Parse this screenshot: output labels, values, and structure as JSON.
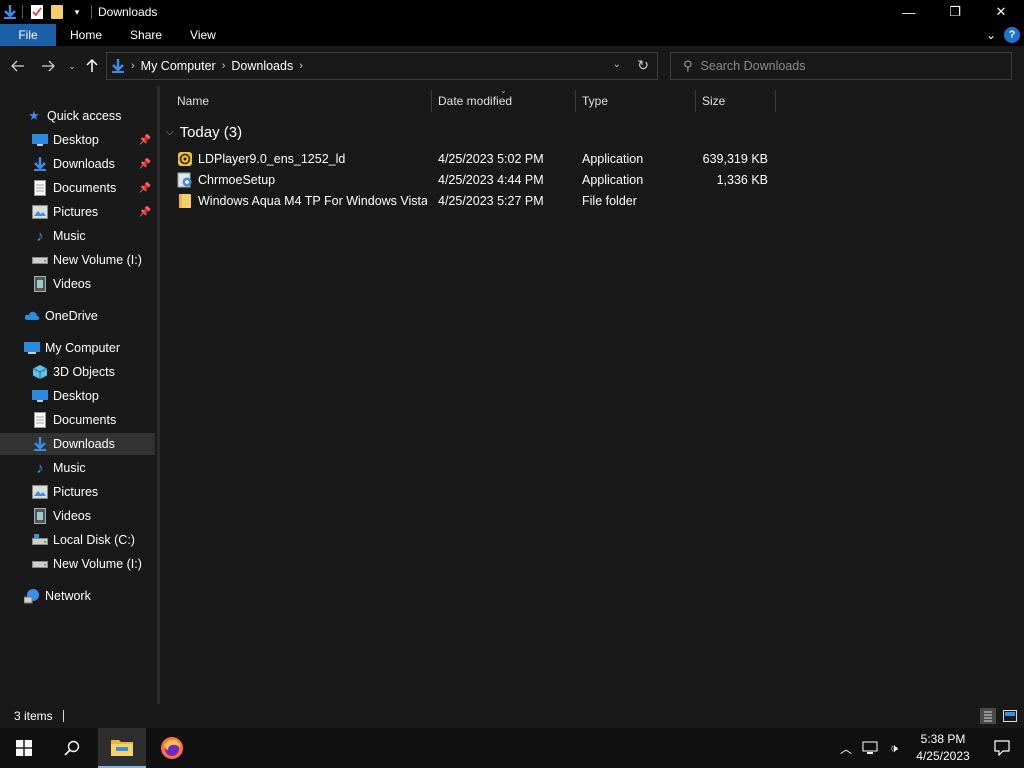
{
  "window": {
    "title": "Downloads",
    "controls": {
      "minimize": "—",
      "maximize": "❐",
      "close": "✕"
    }
  },
  "ribbon": {
    "tabs": [
      {
        "label": "File"
      },
      {
        "label": "Share"
      },
      {
        "label": "View"
      }
    ],
    "home_label": "Home",
    "expand_icon": "chevron-down-icon",
    "help": "?"
  },
  "address": {
    "crumbs": [
      "My Computer",
      "Downloads"
    ],
    "search_placeholder": "Search Downloads"
  },
  "nav": {
    "quick_access": "Quick access",
    "quick_items": [
      {
        "label": "Desktop",
        "icon": "desktop-icon",
        "pinned": true
      },
      {
        "label": "Downloads",
        "icon": "downloads-icon",
        "pinned": true
      },
      {
        "label": "Documents",
        "icon": "documents-icon",
        "pinned": true
      },
      {
        "label": "Pictures",
        "icon": "pictures-icon",
        "pinned": true
      },
      {
        "label": "Music",
        "icon": "music-icon",
        "pinned": false
      },
      {
        "label": "New Volume (I:)",
        "icon": "drive-icon",
        "pinned": false
      },
      {
        "label": "Videos",
        "icon": "videos-icon",
        "pinned": false
      }
    ],
    "onedrive": "OneDrive",
    "my_computer": "My Computer",
    "computer_items": [
      {
        "label": "3D Objects",
        "icon": "3d-objects-icon"
      },
      {
        "label": "Desktop",
        "icon": "desktop-icon"
      },
      {
        "label": "Documents",
        "icon": "documents-icon"
      },
      {
        "label": "Downloads",
        "icon": "downloads-icon",
        "selected": true
      },
      {
        "label": "Music",
        "icon": "music-icon"
      },
      {
        "label": "Pictures",
        "icon": "pictures-icon"
      },
      {
        "label": "Videos",
        "icon": "videos-icon"
      },
      {
        "label": "Local Disk (C:)",
        "icon": "local-disk-icon"
      },
      {
        "label": "New Volume (I:)",
        "icon": "drive-icon"
      }
    ],
    "network": "Network"
  },
  "columns": {
    "name": "Name",
    "date": "Date modified",
    "type": "Type",
    "size": "Size"
  },
  "group": {
    "label": "Today (3)"
  },
  "files": [
    {
      "name": "LDPlayer9.0_ens_1252_ld",
      "date": "4/25/2023 5:02 PM",
      "type": "Application",
      "size": "639,319 KB",
      "icon": "ldplayer-icon"
    },
    {
      "name": "ChrmoeSetup",
      "date": "4/25/2023 4:44 PM",
      "type": "Application",
      "size": "1,336 KB",
      "icon": "setup-icon"
    },
    {
      "name": "Windows Aqua M4 TP For Windows Vista...",
      "date": "4/25/2023 5:27 PM",
      "type": "File folder",
      "size": "",
      "icon": "folder-icon"
    }
  ],
  "status": {
    "items": "3 items"
  },
  "taskbar": {
    "time": "5:38 PM",
    "date": "4/25/2023"
  },
  "colors": {
    "accent": "#1a5fa8",
    "background": "#191919",
    "selected": "#333333",
    "folder": "#f4cf6a"
  }
}
